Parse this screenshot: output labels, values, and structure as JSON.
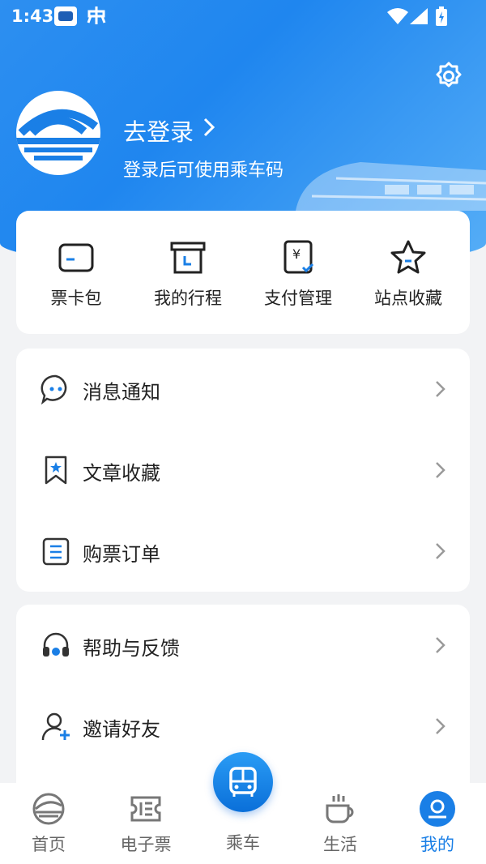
{
  "status_bar": {
    "time": "1:43"
  },
  "profile": {
    "login_title": "去登录",
    "login_subtitle": "登录后可使用乘车码"
  },
  "quick_actions": [
    {
      "label": "票卡包",
      "icon": "card-icon"
    },
    {
      "label": "我的行程",
      "icon": "itinerary-icon"
    },
    {
      "label": "支付管理",
      "icon": "payment-icon"
    },
    {
      "label": "站点收藏",
      "icon": "star-icon"
    }
  ],
  "menu_group_1": [
    {
      "label": "消息通知",
      "icon": "message-icon"
    },
    {
      "label": "文章收藏",
      "icon": "bookmark-icon"
    },
    {
      "label": "购票订单",
      "icon": "order-icon"
    }
  ],
  "menu_group_2": [
    {
      "label": "帮助与反馈",
      "icon": "headset-icon"
    },
    {
      "label": "邀请好友",
      "icon": "invite-user-icon"
    }
  ],
  "tabs": [
    {
      "label": "首页",
      "icon": "home-logo-icon"
    },
    {
      "label": "电子票",
      "icon": "ticket-icon"
    },
    {
      "label": "乘车",
      "icon": "bus-icon"
    },
    {
      "label": "生活",
      "icon": "coffee-icon"
    },
    {
      "label": "我的",
      "icon": "profile-icon",
      "active": true
    }
  ],
  "colors": {
    "primary": "#1a7fe6",
    "header_gradient_start": "#2d8ff0",
    "header_gradient_end": "#56aef7",
    "background": "#f2f3f5"
  }
}
